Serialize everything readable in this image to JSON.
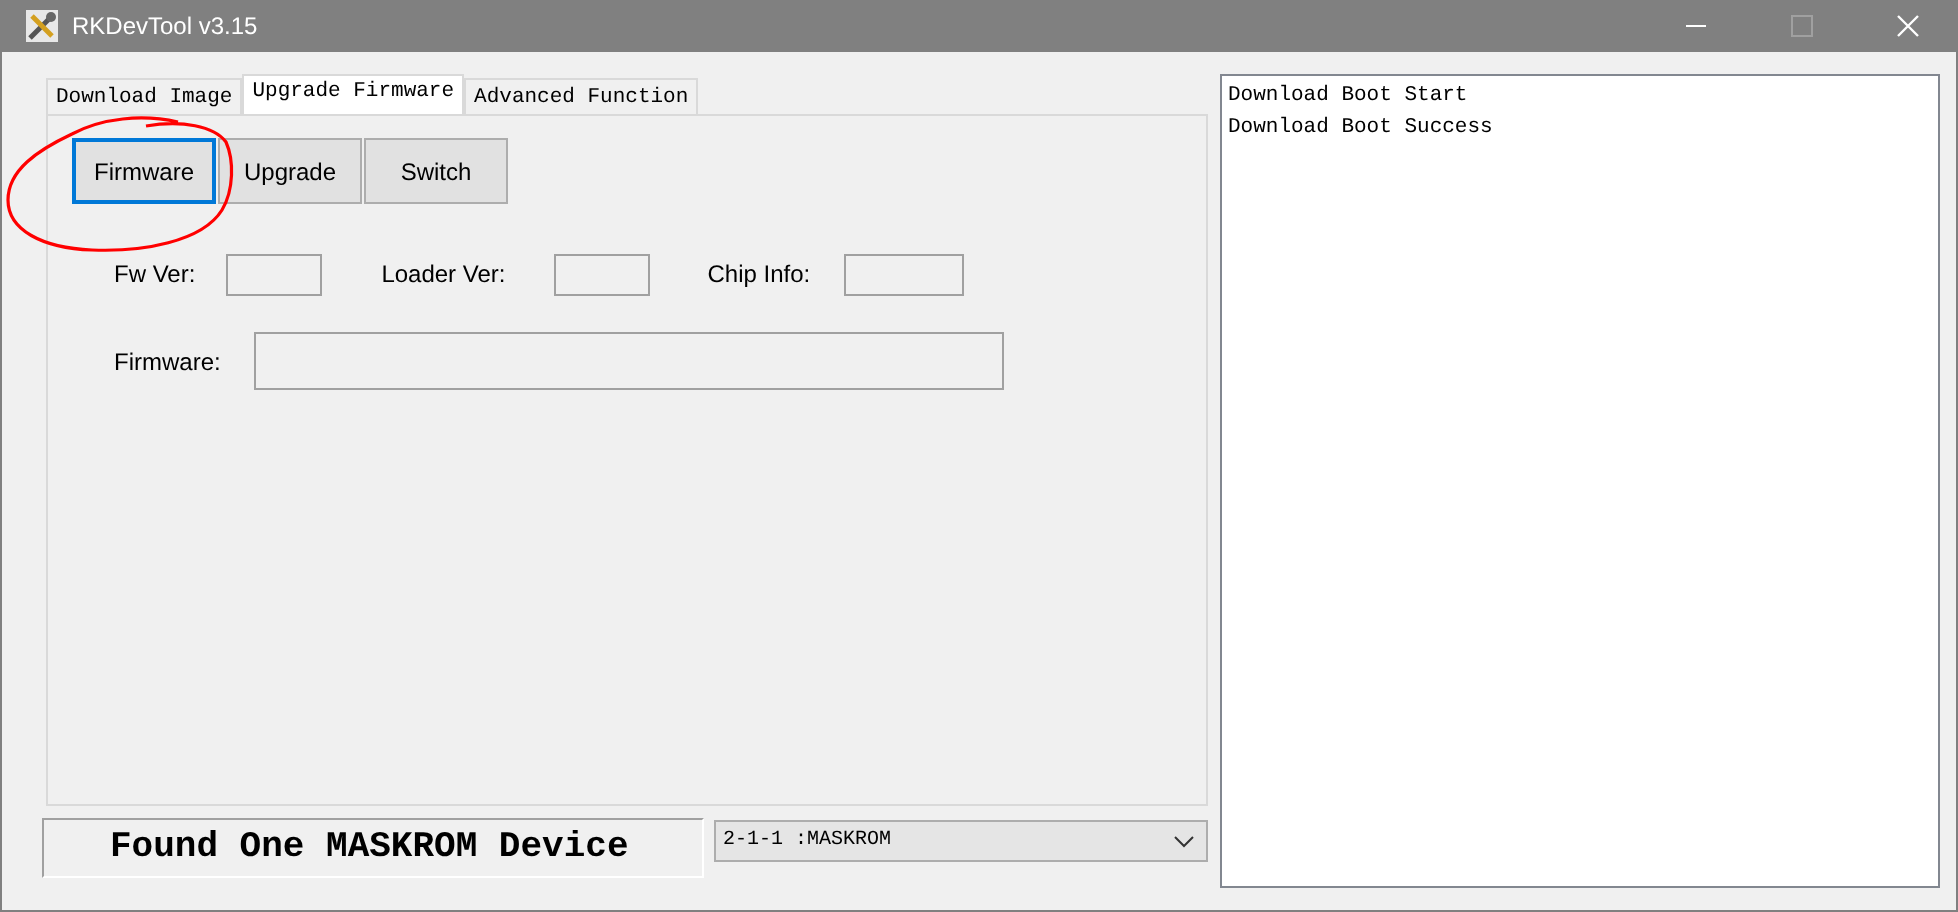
{
  "window": {
    "title": "RKDevTool v3.15"
  },
  "tabs": [
    {
      "label": "Download Image",
      "selected": false
    },
    {
      "label": "Upgrade Firmware",
      "selected": true
    },
    {
      "label": "Advanced Function",
      "selected": false
    }
  ],
  "buttons": [
    {
      "label": "Firmware",
      "focused": true
    },
    {
      "label": "Upgrade",
      "focused": false
    },
    {
      "label": "Switch",
      "focused": false
    }
  ],
  "info_fields": [
    {
      "label": "Fw Ver:"
    },
    {
      "label": "Loader Ver:"
    },
    {
      "label": "Chip Info:"
    }
  ],
  "firmware_field": {
    "label": "Firmware:"
  },
  "status": "Found One MASKROM Device",
  "device_select": {
    "value": "2-1-1 :MASKROM"
  },
  "log": [
    "Download Boot Start",
    "Download Boot Success"
  ]
}
